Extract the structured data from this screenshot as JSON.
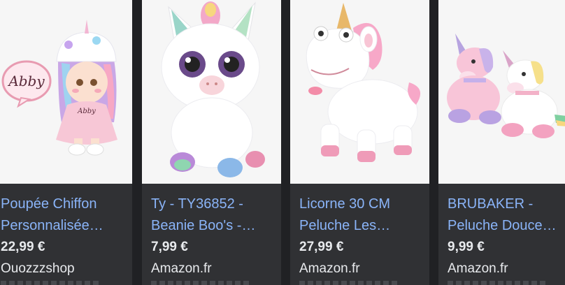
{
  "products": [
    {
      "title_line1": "Poupée Chiffon",
      "title_line2": "Personnalisée…",
      "price": "22,99 €",
      "seller": "Ouozzzshop",
      "image_name_label": "Abby",
      "doll_shirt_label": "Abby"
    },
    {
      "title_line1": "Ty - TY36852 -",
      "title_line2": "Beanie Boo's -…",
      "price": "7,99 €",
      "seller": "Amazon.fr"
    },
    {
      "title_line1": "Licorne 30 CM",
      "title_line2": "Peluche Les…",
      "price": "27,99 €",
      "seller": "Amazon.fr"
    },
    {
      "title_line1": "BRUBAKER -",
      "title_line2": "Peluche Douce…",
      "price": "9,99 €",
      "seller": "Amazon.fr"
    }
  ],
  "colors": {
    "background": "#202124",
    "card": "#303134",
    "link": "#8ab4f8",
    "text": "#e8eaed",
    "thumb_bg": "#f6f6f6"
  }
}
